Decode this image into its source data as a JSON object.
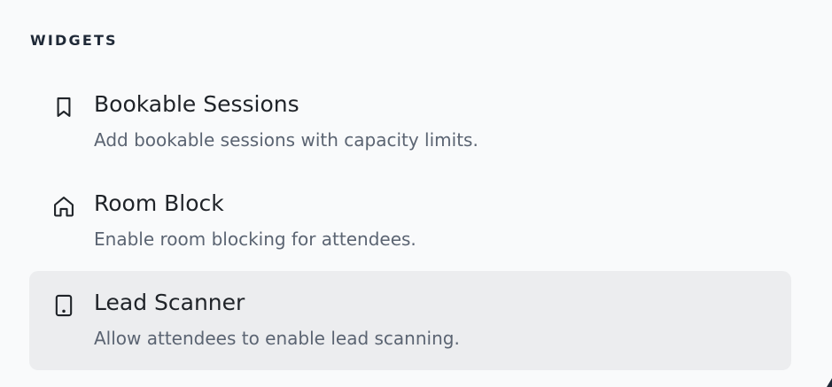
{
  "section": {
    "title": "WIDGETS"
  },
  "widgets": [
    {
      "icon": "bookmark-icon",
      "title": "Bookable Sessions",
      "description": "Add bookable sessions with capacity limits.",
      "active": false
    },
    {
      "icon": "home-icon",
      "title": "Room Block",
      "description": "Enable room blocking for attendees.",
      "active": false
    },
    {
      "icon": "tablet-icon",
      "title": "Lead Scanner",
      "description": "Allow attendees to enable lead scanning.",
      "active": true
    }
  ],
  "colors": {
    "background": "#f9fafb",
    "active_item": "#ecedef",
    "title_text": "#1f2328",
    "description_text": "#5b6472"
  }
}
